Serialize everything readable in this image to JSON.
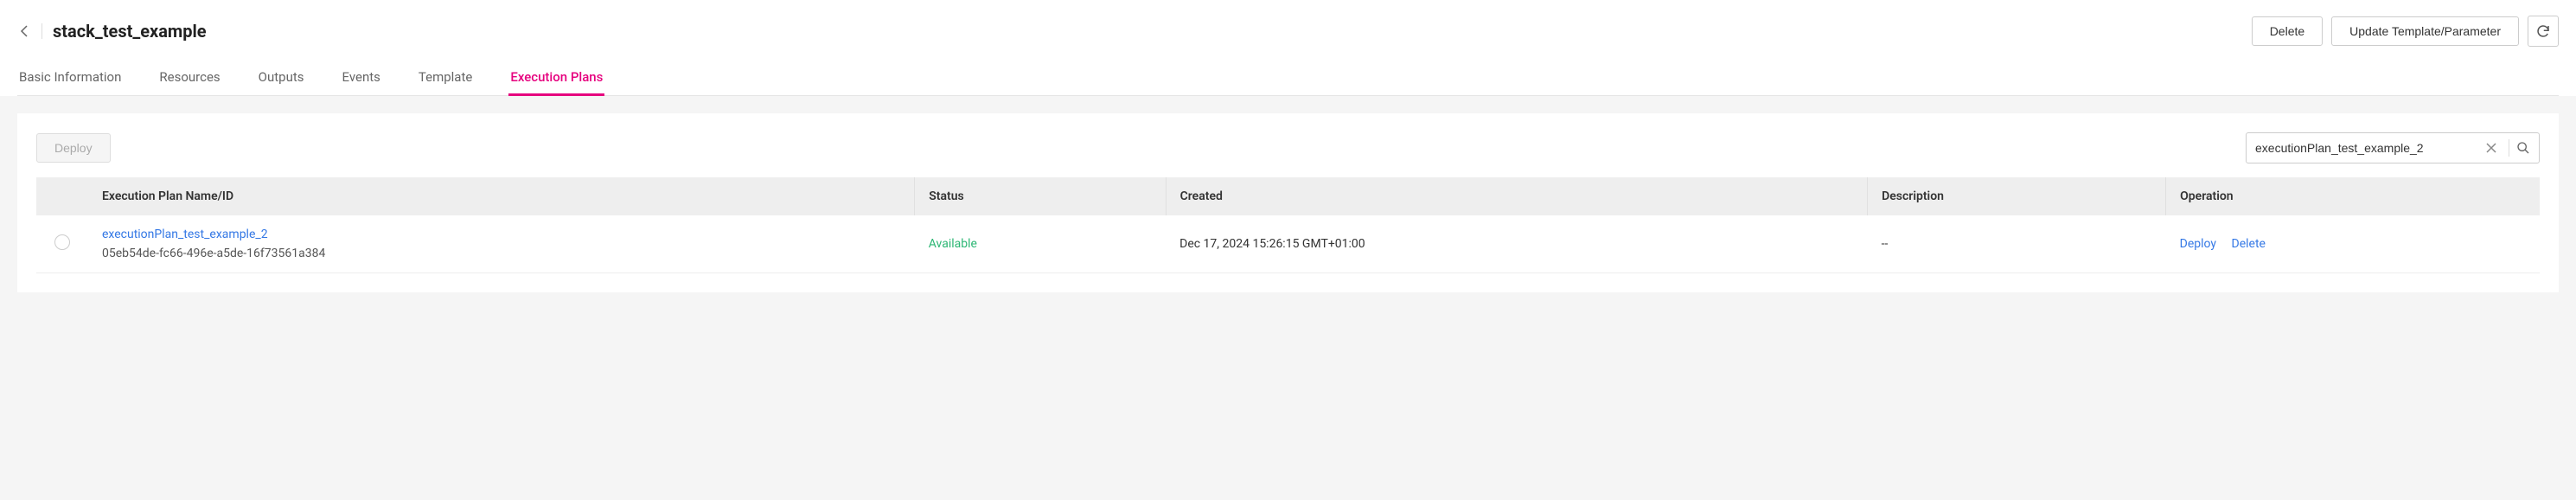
{
  "header": {
    "title": "stack_test_example",
    "delete_label": "Delete",
    "update_label": "Update Template/Parameter"
  },
  "tabs": [
    {
      "label": "Basic Information"
    },
    {
      "label": "Resources"
    },
    {
      "label": "Outputs"
    },
    {
      "label": "Events"
    },
    {
      "label": "Template"
    },
    {
      "label": "Execution Plans"
    }
  ],
  "toolbar": {
    "deploy_label": "Deploy",
    "search_value": "executionPlan_test_example_2"
  },
  "table": {
    "columns": {
      "name": "Execution Plan Name/ID",
      "status": "Status",
      "created": "Created",
      "description": "Description",
      "operation": "Operation"
    },
    "row": {
      "name": "executionPlan_test_example_2",
      "id": "05eb54de-fc66-496e-a5de-16f73561a384",
      "status": "Available",
      "created": "Dec 17, 2024 15:26:15 GMT+01:00",
      "description": "--",
      "op_deploy": "Deploy",
      "op_delete": "Delete"
    }
  }
}
